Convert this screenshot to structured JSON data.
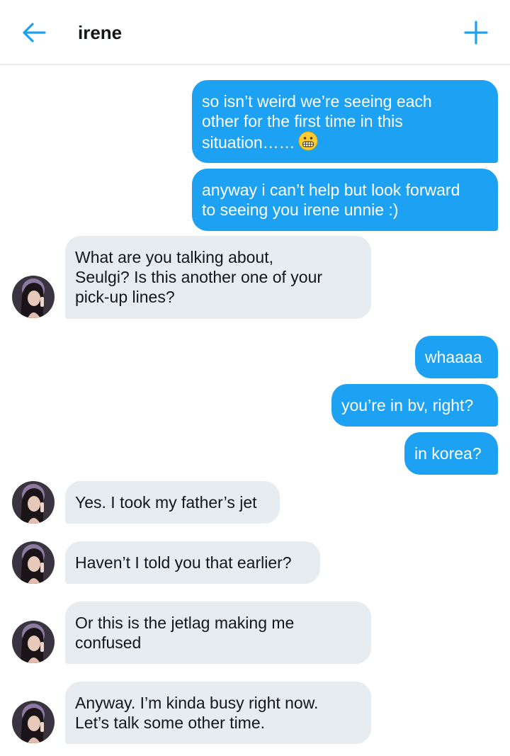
{
  "header": {
    "title": "irene",
    "back_icon": "arrow-left-icon",
    "add_icon": "plus-icon",
    "accent": "#1da1f2"
  },
  "colors": {
    "outgoing_bubble": "#1da1f2",
    "incoming_bubble": "#e6ecf0",
    "incoming_text": "#14171a"
  },
  "messages": [
    {
      "side": "out",
      "text": "so isn’t weird we’re seeing each\nother for the first time in this\nsituation……",
      "emoji": "grimacing-face-emoji"
    },
    {
      "side": "out",
      "text": "anyway i can’t help but look forward\nto seeing you irene unnie :)"
    },
    {
      "side": "in",
      "text": "What are you talking about,\nSeulgi? Is this another one of your\npick-up lines?"
    },
    {
      "side": "out",
      "text": "whaaaa"
    },
    {
      "side": "out",
      "text": "you’re in bv, right?"
    },
    {
      "side": "out",
      "text": "in korea?"
    },
    {
      "side": "in",
      "text": "Yes. I took my father’s jet"
    },
    {
      "side": "in",
      "text": "Haven’t I told you that earlier?"
    },
    {
      "side": "in",
      "text": "Or this is the jetlag making me\nconfused"
    },
    {
      "side": "in",
      "text": "Anyway. I’m kinda busy right now.\nLet’s talk some other time."
    }
  ]
}
